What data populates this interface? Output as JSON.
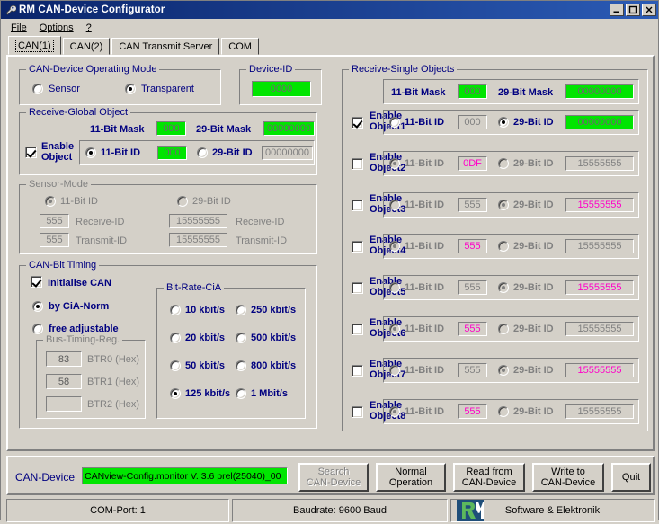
{
  "window": {
    "title": "RM CAN-Device Configurator",
    "icon": "wrench-icon",
    "minimize_label": "—",
    "maximize_label": "□",
    "close_label": "✕"
  },
  "menu": {
    "items": [
      "File",
      "Options",
      "?"
    ]
  },
  "tabs": {
    "items": [
      {
        "label": "CAN(1)",
        "active": true
      },
      {
        "label": "CAN(2)",
        "active": false
      },
      {
        "label": "CAN Transmit Server",
        "active": false
      },
      {
        "label": "COM",
        "active": false
      }
    ]
  },
  "operating_mode": {
    "legend": "CAN-Device Operating Mode",
    "options": [
      {
        "label": "Sensor",
        "selected": false
      },
      {
        "label": "Transparent",
        "selected": true
      }
    ]
  },
  "device_id": {
    "legend": "Device-ID",
    "value": "0000"
  },
  "receive_global": {
    "legend": "Receive-Global Object",
    "mask11_label": "11-Bit Mask",
    "mask11_value": "000",
    "mask29_label": "29-Bit Mask",
    "mask29_value": "00000000",
    "enable_label_line1": "Enable",
    "enable_label_line2": "Object",
    "enabled": true,
    "id11_label": "11-Bit ID",
    "id11_value": "000",
    "id11_selected": true,
    "id29_label": "29-Bit ID",
    "id29_value": "00000000",
    "id29_selected": false
  },
  "sensor_mode": {
    "legend": "Sensor-Mode",
    "disabled": true,
    "id11_label": "11-Bit ID",
    "id11_selected": true,
    "id29_label": "29-Bit ID",
    "id29_selected": false,
    "rx11_value": "555",
    "rx11_label": "Receive-ID",
    "tx11_value": "555",
    "tx11_label": "Transmit-ID",
    "rx29_value": "15555555",
    "rx29_label": "Receive-ID",
    "tx29_value": "15555555",
    "tx29_label": "Transmit-ID"
  },
  "bit_timing": {
    "legend": "CAN-Bit Timing",
    "init_label": "Initialise CAN",
    "init_checked": true,
    "by_cia_label": "by CiA-Norm",
    "by_cia_selected": true,
    "free_label": "free adjustable",
    "free_selected": false,
    "bus_timing": {
      "legend": "Bus-Timing-Reg.",
      "disabled": true,
      "rows": [
        {
          "value": "83",
          "label": "BTR0 (Hex)"
        },
        {
          "value": "58",
          "label": "BTR1 (Hex)"
        },
        {
          "value": "",
          "label": "BTR2 (Hex)"
        }
      ]
    },
    "bitrate": {
      "legend": "Bit-Rate-CiA",
      "options": [
        {
          "label": "10 kbit/s",
          "selected": false
        },
        {
          "label": "250 kbit/s",
          "selected": false
        },
        {
          "label": "20 kbit/s",
          "selected": false
        },
        {
          "label": "500 kbit/s",
          "selected": false
        },
        {
          "label": "50 kbit/s",
          "selected": false
        },
        {
          "label": "800 kbit/s",
          "selected": false
        },
        {
          "label": "125 kbit/s",
          "selected": true
        },
        {
          "label": "1 Mbit/s",
          "selected": false
        }
      ]
    }
  },
  "receive_single": {
    "legend": "Receive-Single Objects",
    "mask11_label": "11-Bit Mask",
    "mask11_value": "000",
    "mask29_label": "29-Bit Mask",
    "mask29_value": "00000000",
    "id11_label": "11-Bit ID",
    "id29_label": "29-Bit ID",
    "objects": [
      {
        "enable_line1": "Enable",
        "enable_line2": "Object1",
        "enabled": true,
        "disabled": false,
        "id11_value": "000",
        "id11_selected": false,
        "id29_value": "00000000",
        "id29_selected": true,
        "id11_style": "grey",
        "id29_style": "green"
      },
      {
        "enable_line1": "Enable",
        "enable_line2": "Object2",
        "enabled": false,
        "disabled": true,
        "id11_value": "0DF",
        "id11_selected": true,
        "id29_value": "15555555",
        "id29_selected": false,
        "id11_style": "magenta",
        "id29_style": "grey"
      },
      {
        "enable_line1": "Enable",
        "enable_line2": "Object3",
        "enabled": false,
        "disabled": true,
        "id11_value": "555",
        "id11_selected": false,
        "id29_value": "15555555",
        "id29_selected": true,
        "id11_style": "grey",
        "id29_style": "magenta"
      },
      {
        "enable_line1": "Enable",
        "enable_line2": "Object4",
        "enabled": false,
        "disabled": true,
        "id11_value": "555",
        "id11_selected": true,
        "id29_value": "15555555",
        "id29_selected": false,
        "id11_style": "magenta",
        "id29_style": "grey"
      },
      {
        "enable_line1": "Enable",
        "enable_line2": "Object5",
        "enabled": false,
        "disabled": true,
        "id11_value": "555",
        "id11_selected": false,
        "id29_value": "15555555",
        "id29_selected": true,
        "id11_style": "grey",
        "id29_style": "magenta"
      },
      {
        "enable_line1": "Enable",
        "enable_line2": "Object6",
        "enabled": false,
        "disabled": true,
        "id11_value": "555",
        "id11_selected": true,
        "id29_value": "15555555",
        "id29_selected": false,
        "id11_style": "magenta",
        "id29_style": "grey"
      },
      {
        "enable_line1": "Enable",
        "enable_line2": "Object7",
        "enabled": false,
        "disabled": true,
        "id11_value": "555",
        "id11_selected": false,
        "id29_value": "15555555",
        "id29_selected": true,
        "id11_style": "grey",
        "id29_style": "magenta"
      },
      {
        "enable_line1": "Enable",
        "enable_line2": "Object8",
        "enabled": false,
        "disabled": true,
        "id11_value": "555",
        "id11_selected": true,
        "id29_value": "15555555",
        "id29_selected": false,
        "id11_style": "magenta",
        "id29_style": "grey"
      }
    ]
  },
  "action_bar": {
    "can_device_label": "CAN-Device",
    "can_device_value": "CANview-Config.monitor V. 3.6 prel(25040)_00",
    "buttons": [
      {
        "line1": "Search",
        "line2": "CAN-Device",
        "disabled": true
      },
      {
        "line1": "Normal",
        "line2": "Operation",
        "disabled": false
      },
      {
        "line1": "Read from",
        "line2": "CAN-Device",
        "disabled": false
      },
      {
        "line1": "Write to",
        "line2": "CAN-Device",
        "disabled": false
      },
      {
        "line1": "Quit",
        "line2": "",
        "disabled": false
      }
    ]
  },
  "status_bar": {
    "com_port": "COM-Port: 1",
    "baudrate": "Baudrate: 9600 Baud",
    "logo": "rm-logo",
    "company": "Software & Elektronik"
  },
  "colors": {
    "face": "#d4d0c8",
    "green_field": "#00e500",
    "magenta_text": "#ff00c8",
    "label_blue": "#000080",
    "title_blue": "#0a246a"
  }
}
